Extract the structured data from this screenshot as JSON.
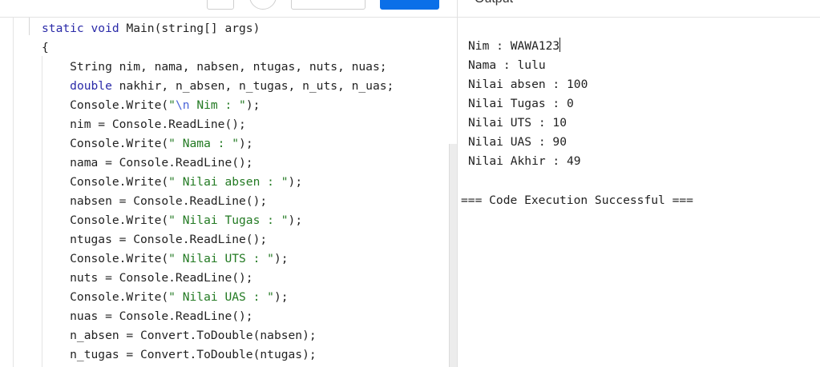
{
  "toolbar": {
    "output_label": "Output"
  },
  "editor": {
    "lines": [
      [
        {
          "t": "static void ",
          "c": "kw"
        },
        {
          "t": "Main(string[] args)",
          "c": ""
        }
      ],
      [
        {
          "t": "{",
          "c": ""
        }
      ],
      [
        {
          "t": "    String nim, nama, nabsen, ntugas, nuts, nuas;",
          "c": ""
        }
      ],
      [
        {
          "t": "    ",
          "c": ""
        },
        {
          "t": "double",
          "c": "kw"
        },
        {
          "t": " nakhir, n_absen, n_tugas, n_uts, n_uas;",
          "c": ""
        }
      ],
      [
        {
          "t": "    Console.Write(",
          "c": ""
        },
        {
          "t": "\"",
          "c": "str"
        },
        {
          "t": "\\n",
          "c": "esc"
        },
        {
          "t": " Nim : \"",
          "c": "str"
        },
        {
          "t": ");",
          "c": ""
        }
      ],
      [
        {
          "t": "    nim = Console.ReadLine();",
          "c": ""
        }
      ],
      [
        {
          "t": "    Console.Write(",
          "c": ""
        },
        {
          "t": "\" Nama : \"",
          "c": "str"
        },
        {
          "t": ");",
          "c": ""
        }
      ],
      [
        {
          "t": "    nama = Console.ReadLine();",
          "c": ""
        }
      ],
      [
        {
          "t": "    Console.Write(",
          "c": ""
        },
        {
          "t": "\" Nilai absen : \"",
          "c": "str"
        },
        {
          "t": ");",
          "c": ""
        }
      ],
      [
        {
          "t": "    nabsen = Console.ReadLine();",
          "c": ""
        }
      ],
      [
        {
          "t": "    Console.Write(",
          "c": ""
        },
        {
          "t": "\" Nilai Tugas : \"",
          "c": "str"
        },
        {
          "t": ");",
          "c": ""
        }
      ],
      [
        {
          "t": "    ntugas = Console.ReadLine();",
          "c": ""
        }
      ],
      [
        {
          "t": "    Console.Write(",
          "c": ""
        },
        {
          "t": "\" Nilai UTS : \"",
          "c": "str"
        },
        {
          "t": ");",
          "c": ""
        }
      ],
      [
        {
          "t": "    nuts = Console.ReadLine();",
          "c": ""
        }
      ],
      [
        {
          "t": "    Console.Write(",
          "c": ""
        },
        {
          "t": "\" Nilai UAS : \"",
          "c": "str"
        },
        {
          "t": ");",
          "c": ""
        }
      ],
      [
        {
          "t": "    nuas = Console.ReadLine();",
          "c": ""
        }
      ],
      [
        {
          "t": "    n_absen = Convert.ToDouble(nabsen);",
          "c": ""
        }
      ],
      [
        {
          "t": "    n_tugas = Convert.ToDouble(ntugas);",
          "c": ""
        }
      ]
    ]
  },
  "output": {
    "lines": [
      "Nim : WAWA123",
      "Nama : lulu",
      "Nilai absen : 100",
      "Nilai Tugas : 0",
      "Nilai UTS : 10",
      "Nilai UAS : 90",
      "Nilai Akhir : 49"
    ],
    "status": "=== Code Execution Successful ==="
  },
  "colors": {
    "keyword": "#2a2aa8",
    "string": "#237a23",
    "escape": "#4a63d8",
    "run_button": "#0a6fe8"
  }
}
